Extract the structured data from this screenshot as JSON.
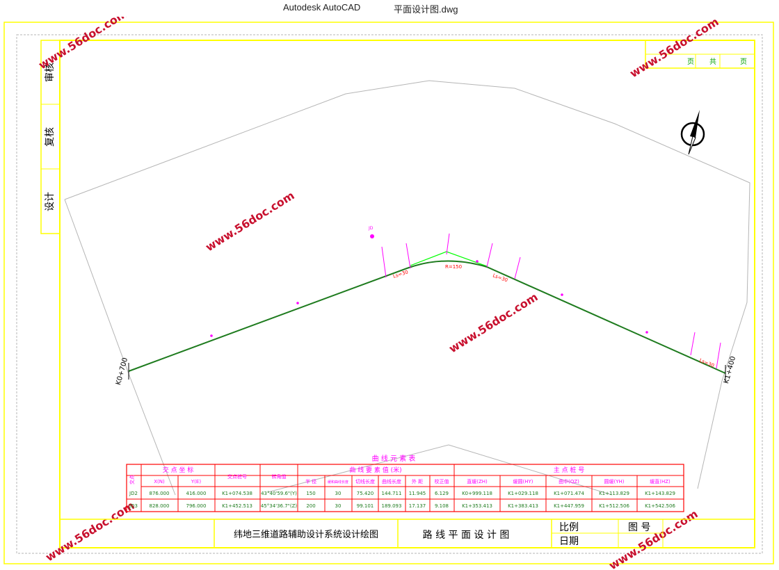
{
  "window": {
    "app_title": "Autodesk AutoCAD",
    "doc_title": "平面设计图.dwg"
  },
  "side_labels": [
    "审核",
    "复核",
    "设计"
  ],
  "page_box": {
    "page_label": "页",
    "total_label": "共",
    "page_label2": "页"
  },
  "watermark": "www.56doc.com",
  "stations": {
    "start": "K0+700",
    "end": "K1+400"
  },
  "curve_labels": {
    "r1": "R=150",
    "ls1a": "Ls=30",
    "ls1b": "Ls=30",
    "ls2": "Ls=30",
    "jd_mark": "JD"
  },
  "table": {
    "title": "曲 线 元 素 表",
    "headers": {
      "jd": "交点",
      "coords": "交 点 坐 标",
      "x": "X(N)",
      "y": "Y(E)",
      "station": "交点桩号",
      "angle": "转角值",
      "elements": "曲 线 要 素 值 (米)",
      "radius": "半 径",
      "ls": "缓和曲线长度",
      "tangent": "切线长度",
      "curve_len": "曲线长度",
      "external": "外 距",
      "correction": "校正值",
      "main_points": "主 点 桩 号",
      "zh": "直缓(ZH)",
      "hy": "缓圆(HY)",
      "qz": "曲中(QZ)",
      "yh": "圆缓(YH)",
      "hz": "缓直(HZ)"
    },
    "rows": [
      {
        "jd": "JD2",
        "x": "876.000",
        "y": "416.000",
        "station": "K1+074.538",
        "angle": "43°40'59.6\"(Y)",
        "radius": "150",
        "ls": "30",
        "tangent": "75.420",
        "curve_len": "144.711",
        "external": "11.945",
        "correction": "6.129",
        "zh": "K0+999.118",
        "hy": "K1+029.118",
        "qz": "K1+071.474",
        "yh": "K1+113.829",
        "hz": "K1+143.829"
      },
      {
        "jd": "JD3",
        "x": "828.000",
        "y": "796.000",
        "station": "K1+452.513",
        "angle": "45°34'36.7\"(Z)",
        "radius": "200",
        "ls": "30",
        "tangent": "99.101",
        "curve_len": "189.093",
        "external": "17.137",
        "correction": "9.108",
        "zh": "K1+353.413",
        "hy": "K1+383.413",
        "qz": "K1+447.959",
        "yh": "K1+512.506",
        "hz": "K1+542.506"
      }
    ]
  },
  "title_block": {
    "system": "纬地三维道路辅助设计系统设计绘图",
    "drawing": "路 线 平 面 设 计 图",
    "scale": "比例",
    "sheet": "图 号",
    "date": "日期"
  },
  "colors": {
    "frame": "#ffff00",
    "route": "#1e7b1e",
    "tangent_line": "#00ff00",
    "magenta": "#ff00ff",
    "red": "#ff0000",
    "watermark": "#c8102e",
    "boundary": "#b5b5b5"
  }
}
